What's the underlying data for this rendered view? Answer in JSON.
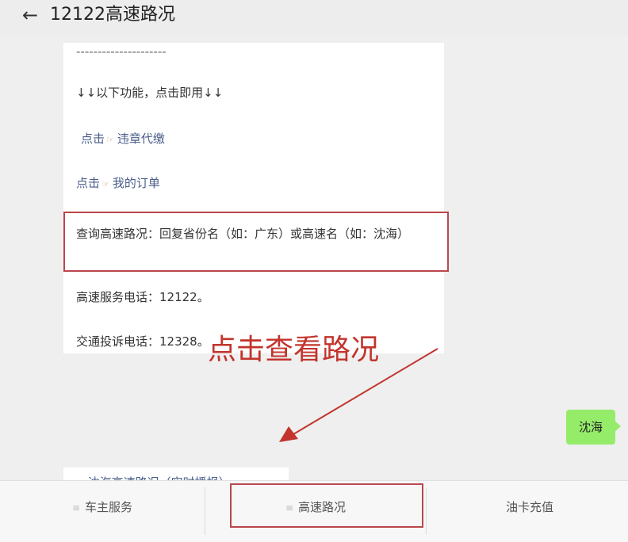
{
  "header": {
    "back_icon": "←",
    "title": "12122高速路况"
  },
  "messages": {
    "dashes": "---------------------",
    "features": "↓↓以下功能，点击即用↓↓",
    "link1_prefix": "点击",
    "link1_icon": "☞",
    "link1_text": "违章代缴",
    "link2_prefix": "点击",
    "link2_icon": "☞",
    "link2_text": "我的订单",
    "query": "查询高速路况：回复省份名（如：广东）或高速名（如：沈海）",
    "service": "高速服务电话：12122。",
    "complaint": "交通投诉电话：12328。"
  },
  "annotation": {
    "text": "点击查看路况",
    "color": "#c2342c"
  },
  "user_message": "沈海",
  "reply_link": "→沈海高速路况（实时播报）",
  "menu": [
    {
      "icon": "≡",
      "label": "车主服务"
    },
    {
      "icon": "≡",
      "label": "高速路况"
    },
    {
      "icon": "",
      "label": "油卡充值"
    }
  ],
  "colors": {
    "link": "#4b5f8a",
    "highlight_border": "#b9474c",
    "user_bubble": "#95ec69"
  }
}
